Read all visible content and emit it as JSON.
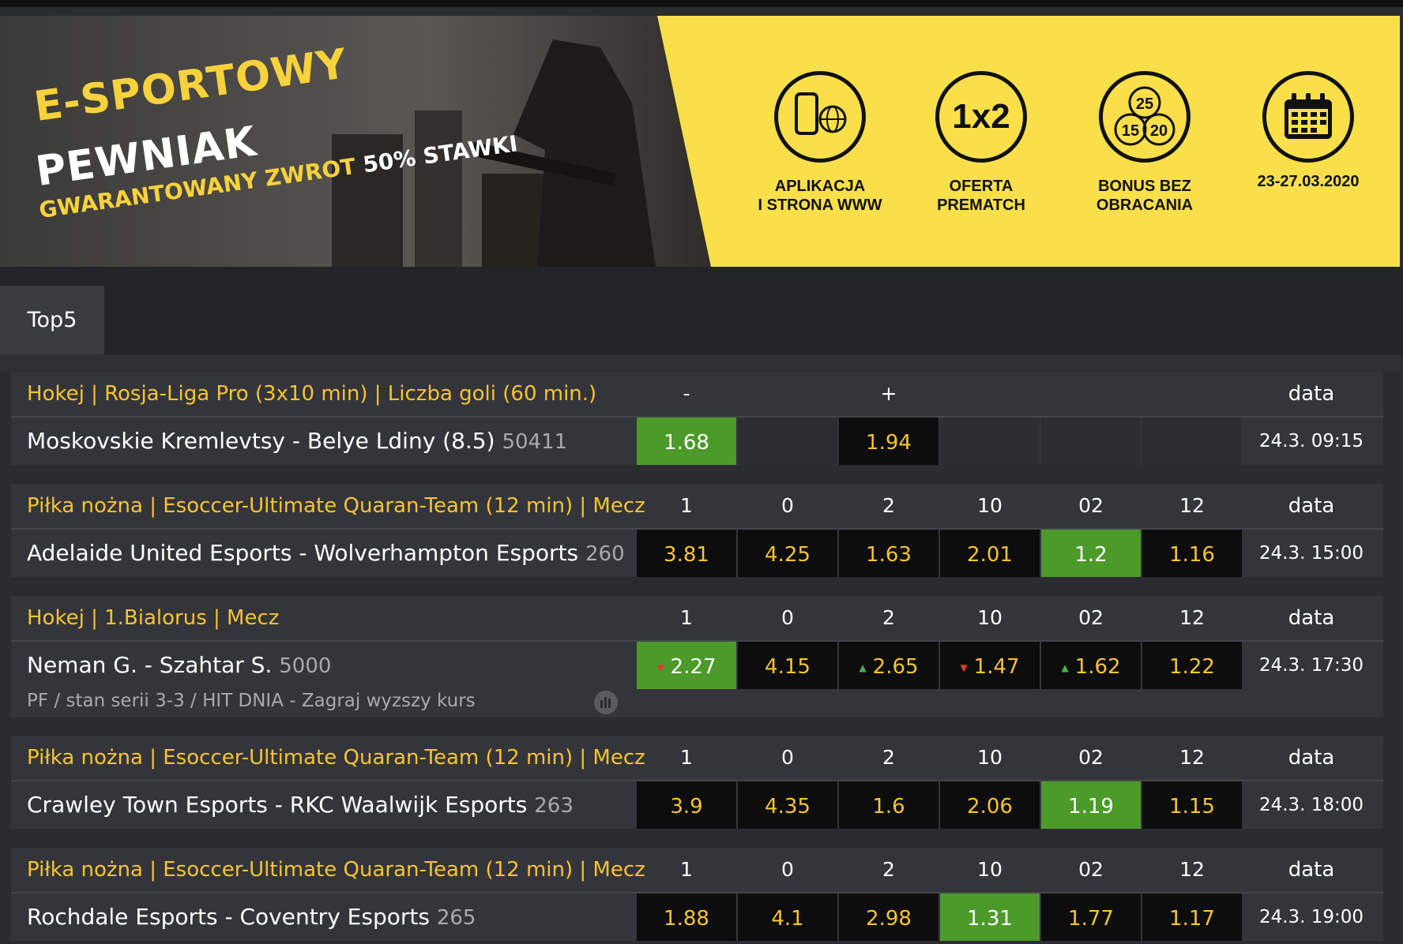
{
  "banner": {
    "title_line1": "E-SPORTOWY",
    "title_line2": "PEWNIAK",
    "subtitle_main": "GWARANTOWANY ZWROT",
    "subtitle_hl": "50% STAWKI",
    "features": [
      {
        "icon": "phone-globe-icon",
        "label": "APLIKACJA\nI STRONA WWW"
      },
      {
        "icon": "1x2-icon",
        "icon_text": "1x2",
        "label": "OFERTA\nPREMATCH"
      },
      {
        "icon": "coins-icon",
        "coin_values": [
          "25",
          "15",
          "20"
        ],
        "label": "BONUS BEZ\nOBRACANIA"
      },
      {
        "icon": "calendar-icon",
        "label": "23-27.03.2020"
      }
    ],
    "colors": {
      "yellow": "#f9df4a",
      "dark": "#111111"
    }
  },
  "tabs": [
    {
      "label": "Top5",
      "active": true
    }
  ],
  "date_header": "data",
  "events": [
    {
      "league": "Hokej | Rosja-Liga Pro (3x10 min) | Liczba goli (60 min.)",
      "columns": [
        "-",
        "",
        "+",
        "",
        "",
        ""
      ],
      "match": "Moskovskie Kremlevtsy - Belye Ldiny (8.5)",
      "match_id": "50411",
      "odds": [
        "1.68",
        "",
        "1.94",
        "",
        "",
        ""
      ],
      "odds_style": [
        "green",
        "empty",
        "dark",
        "empty",
        "empty",
        "empty"
      ],
      "date": "24.3. 09:15"
    },
    {
      "league": "Piłka nożna | Esoccer-Ultimate Quaran-Team (12 min) | Mecz",
      "columns": [
        "1",
        "0",
        "2",
        "10",
        "02",
        "12"
      ],
      "match": "Adelaide United Esports - Wolverhampton Esports",
      "match_id": "260",
      "odds": [
        "3.81",
        "4.25",
        "1.63",
        "2.01",
        "1.2",
        "1.16"
      ],
      "odds_style": [
        "dark",
        "dark",
        "dark",
        "dark",
        "green",
        "dark"
      ],
      "date": "24.3. 15:00"
    },
    {
      "league": "Hokej | 1.Bialorus | Mecz",
      "columns": [
        "1",
        "0",
        "2",
        "10",
        "02",
        "12"
      ],
      "match": "Neman G. - Szahtar S.",
      "match_id": "5000",
      "subtext": "PF / stan serii 3-3 / HIT DNIA - Zagraj wyzszy kurs",
      "odds": [
        "2.27",
        "4.15",
        "2.65",
        "1.47",
        "1.62",
        "1.22"
      ],
      "odds_style": [
        "green",
        "dark",
        "dark",
        "dark",
        "dark",
        "dark"
      ],
      "odds_trend": [
        "down",
        "",
        "up",
        "down",
        "up",
        ""
      ],
      "date": "24.3. 17:30"
    },
    {
      "league": "Piłka nożna | Esoccer-Ultimate Quaran-Team (12 min) | Mecz",
      "columns": [
        "1",
        "0",
        "2",
        "10",
        "02",
        "12"
      ],
      "match": "Crawley Town Esports - RKC Waalwijk Esports",
      "match_id": "263",
      "odds": [
        "3.9",
        "4.35",
        "1.6",
        "2.06",
        "1.19",
        "1.15"
      ],
      "odds_style": [
        "dark",
        "dark",
        "dark",
        "dark",
        "green",
        "dark"
      ],
      "date": "24.3. 18:00"
    },
    {
      "league": "Piłka nożna | Esoccer-Ultimate Quaran-Team (12 min) | Mecz",
      "columns": [
        "1",
        "0",
        "2",
        "10",
        "02",
        "12"
      ],
      "match": "Rochdale Esports - Coventry Esports",
      "match_id": "265",
      "odds": [
        "1.88",
        "4.1",
        "2.98",
        "1.31",
        "1.77",
        "1.17"
      ],
      "odds_style": [
        "dark",
        "dark",
        "dark",
        "green",
        "dark",
        "dark"
      ],
      "date": "24.3. 19:00"
    }
  ]
}
